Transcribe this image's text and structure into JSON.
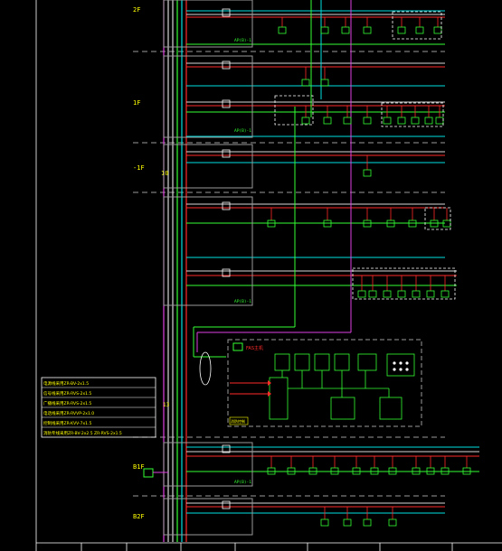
{
  "floors": [
    {
      "label": "2F"
    },
    {
      "label": "1F"
    },
    {
      "label": "-1F"
    },
    {
      "label": "B1F"
    },
    {
      "label": "B2F"
    }
  ],
  "riser_count": "10",
  "riser_count_lower": "13",
  "panel_label": "AP(B)-1",
  "fas_panel_title": "FAS主机",
  "fas_small_label": "消防控制",
  "notes": [
    "电源线采用ZR-BV-2x1.5",
    "信号线采用ZR-RVS-2x1.5",
    "广播线采用ZR-RVS-2x1.5",
    "电话线采用ZR-RVVP-2x1.0",
    "控制线采用ZR-KVV-7x1.5",
    "消防专线采用ZR-BV-2x2.5 ZR-RVS-2x1.5"
  ],
  "colors": {
    "background": "#000000",
    "bus_white": "#d8d8d8",
    "bus_red": "#ff2a2a",
    "bus_cyan": "#00e0e0",
    "bus_magenta": "#e040e0",
    "bus_green": "#33ff33",
    "bus_yellow": "#ffff00",
    "frame": "#ffffff"
  }
}
